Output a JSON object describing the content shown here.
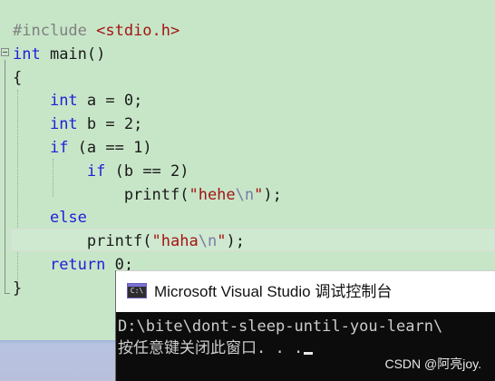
{
  "editor": {
    "lines": [
      {
        "parts": [
          {
            "t": "#include ",
            "c": "pp"
          },
          {
            "t": "<stdio.h>",
            "c": "inc"
          }
        ]
      },
      {
        "parts": [
          {
            "t": "int",
            "c": "kw"
          },
          {
            "t": " main()",
            "c": ""
          }
        ]
      },
      {
        "parts": [
          {
            "t": "{",
            "c": ""
          }
        ]
      },
      {
        "parts": [
          {
            "t": "    ",
            "c": ""
          },
          {
            "t": "int",
            "c": "kw"
          },
          {
            "t": " a = 0;",
            "c": ""
          }
        ]
      },
      {
        "parts": [
          {
            "t": "    ",
            "c": ""
          },
          {
            "t": "int",
            "c": "kw"
          },
          {
            "t": " b = 2;",
            "c": ""
          }
        ]
      },
      {
        "parts": [
          {
            "t": "    ",
            "c": ""
          },
          {
            "t": "if",
            "c": "kw"
          },
          {
            "t": " (a == 1)",
            "c": ""
          }
        ]
      },
      {
        "parts": [
          {
            "t": "        ",
            "c": ""
          },
          {
            "t": "if",
            "c": "kw"
          },
          {
            "t": " (b == 2)",
            "c": ""
          }
        ]
      },
      {
        "parts": [
          {
            "t": "            printf(",
            "c": ""
          },
          {
            "t": "\"hehe",
            "c": "str"
          },
          {
            "t": "\\n",
            "c": "esc"
          },
          {
            "t": "\"",
            "c": "str"
          },
          {
            "t": ");",
            "c": ""
          }
        ]
      },
      {
        "parts": [
          {
            "t": "    ",
            "c": ""
          },
          {
            "t": "else",
            "c": "kw"
          }
        ]
      },
      {
        "parts": [
          {
            "t": "        printf(",
            "c": ""
          },
          {
            "t": "\"haha",
            "c": "str"
          },
          {
            "t": "\\n",
            "c": "esc"
          },
          {
            "t": "\"",
            "c": "str"
          },
          {
            "t": ");",
            "c": ""
          }
        ]
      },
      {
        "parts": [
          {
            "t": "    ",
            "c": ""
          },
          {
            "t": "return",
            "c": "kw"
          },
          {
            "t": " 0;",
            "c": ""
          }
        ]
      },
      {
        "parts": [
          {
            "t": "}",
            "c": ""
          }
        ]
      }
    ]
  },
  "console": {
    "title": "Microsoft Visual Studio 调试控制台",
    "icon_text": "C:\\",
    "output_lines": [
      "D:\\bite\\dont-sleep-until-you-learn\\",
      "按任意键关闭此窗口. . ."
    ]
  },
  "watermark": "CSDN @阿亮joy.",
  "colors": {
    "editor_background": "#c7e6c8",
    "keyword": "#2020d8",
    "string": "#a31515",
    "console_background": "#0c0c0c"
  }
}
